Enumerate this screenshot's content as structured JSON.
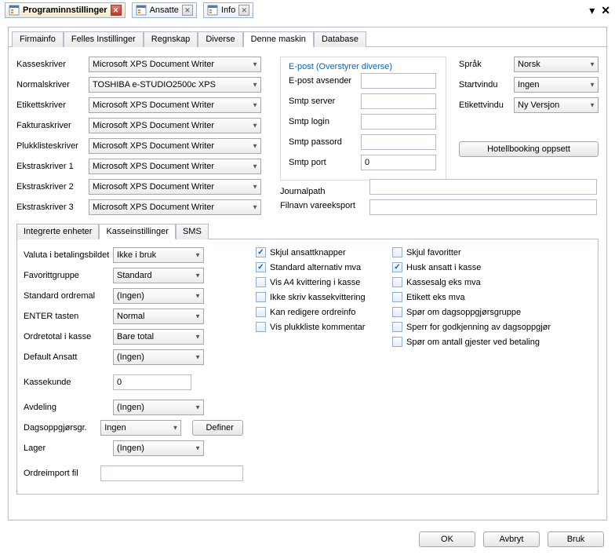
{
  "titleTabs": [
    {
      "label": "Programinnstillinger",
      "active": true
    },
    {
      "label": "Ansatte",
      "active": false
    },
    {
      "label": "Info",
      "active": false
    }
  ],
  "mainTabs": [
    "Firmainfo",
    "Felles Instillinger",
    "Regnskap",
    "Diverse",
    "Denne maskin",
    "Database"
  ],
  "mainTabActive": "Denne maskin",
  "printers": {
    "kasse": {
      "label": "Kasseskriver",
      "value": "Microsoft XPS Document Writer"
    },
    "normal": {
      "label": "Normalskriver",
      "value": "TOSHIBA e-STUDIO2500c XPS"
    },
    "etikett": {
      "label": "Etikettskriver",
      "value": "Microsoft XPS Document Writer"
    },
    "faktura": {
      "label": "Fakturaskriver",
      "value": "Microsoft XPS Document Writer"
    },
    "plukk": {
      "label": "Plukklisteskriver",
      "value": "Microsoft XPS Document Writer"
    },
    "ekstra1": {
      "label": "Ekstraskriver 1",
      "value": "Microsoft XPS Document Writer"
    },
    "ekstra2": {
      "label": "Ekstraskriver 2",
      "value": "Microsoft XPS Document Writer"
    },
    "ekstra3": {
      "label": "Ekstraskriver 3",
      "value": "Microsoft XPS Document Writer"
    }
  },
  "epost": {
    "title": "E-post (Overstyrer diverse)",
    "avsender": {
      "label": "E-post avsender",
      "value": ""
    },
    "server": {
      "label": "Smtp server",
      "value": ""
    },
    "login": {
      "label": "Smtp login",
      "value": ""
    },
    "passord": {
      "label": "Smtp passord",
      "value": ""
    },
    "port": {
      "label": "Smtp port",
      "value": "0"
    }
  },
  "right": {
    "sprak": {
      "label": "Språk",
      "value": "Norsk"
    },
    "startvindu": {
      "label": "Startvindu",
      "value": "Ingen"
    },
    "etikettvindu": {
      "label": "Etikettvindu",
      "value": "Ny Versjon"
    },
    "hotellBtn": "Hotellbooking oppsett"
  },
  "paths": {
    "journal": {
      "label": "Journalpath",
      "value": ""
    },
    "filnavn": {
      "label": "Filnavn vareeksport",
      "value": ""
    }
  },
  "subTabs": [
    "Integrerte enheter",
    "Kasseinstillinger",
    "SMS"
  ],
  "subTabActive": "Kasseinstillinger",
  "kasse": {
    "valuta": {
      "label": "Valuta i betalingsbildet",
      "value": "Ikke i bruk"
    },
    "favgrp": {
      "label": "Favorittgruppe",
      "value": "Standard"
    },
    "stdordre": {
      "label": "Standard ordremal",
      "value": "(Ingen)"
    },
    "enter": {
      "label": "ENTER tasten",
      "value": "Normal"
    },
    "ordretot": {
      "label": "Ordretotal i kasse",
      "value": "Bare total"
    },
    "defans": {
      "label": "Default Ansatt",
      "value": "(Ingen)"
    },
    "kassekunde": {
      "label": "Kassekunde",
      "value": "0"
    },
    "avdeling": {
      "label": "Avdeling",
      "value": "(Ingen)"
    },
    "dagsopp": {
      "label": "Dagsoppgjørsgr.",
      "value": "Ingen"
    },
    "lager": {
      "label": "Lager",
      "value": "(Ingen)"
    },
    "ordreimp": {
      "label": "Ordreimport fil",
      "value": ""
    },
    "definerBtn": "Definer"
  },
  "checksLeft": [
    {
      "label": "Skjul ansattknapper",
      "checked": true
    },
    {
      "label": "Standard alternativ mva",
      "checked": true
    },
    {
      "label": "Vis A4 kvittering i kasse",
      "checked": false
    },
    {
      "label": "Ikke skriv kassekvittering",
      "checked": false
    },
    {
      "label": "Kan redigere ordreinfo",
      "checked": false
    },
    {
      "label": "Vis plukkliste kommentar",
      "checked": false
    }
  ],
  "checksRight": [
    {
      "label": "Skjul favoritter",
      "checked": false
    },
    {
      "label": "Husk ansatt i kasse",
      "checked": true
    },
    {
      "label": "Kassesalg eks mva",
      "checked": false
    },
    {
      "label": "Etikett eks mva",
      "checked": false
    },
    {
      "label": "Spør om dagsoppgjørsgruppe",
      "checked": false
    },
    {
      "label": "Sperr for godkjenning av dagsoppgjør",
      "checked": false
    },
    {
      "label": "Spør om antall gjester ved betaling",
      "checked": false
    }
  ],
  "buttons": {
    "ok": "OK",
    "avbryt": "Avbryt",
    "bruk": "Bruk"
  }
}
